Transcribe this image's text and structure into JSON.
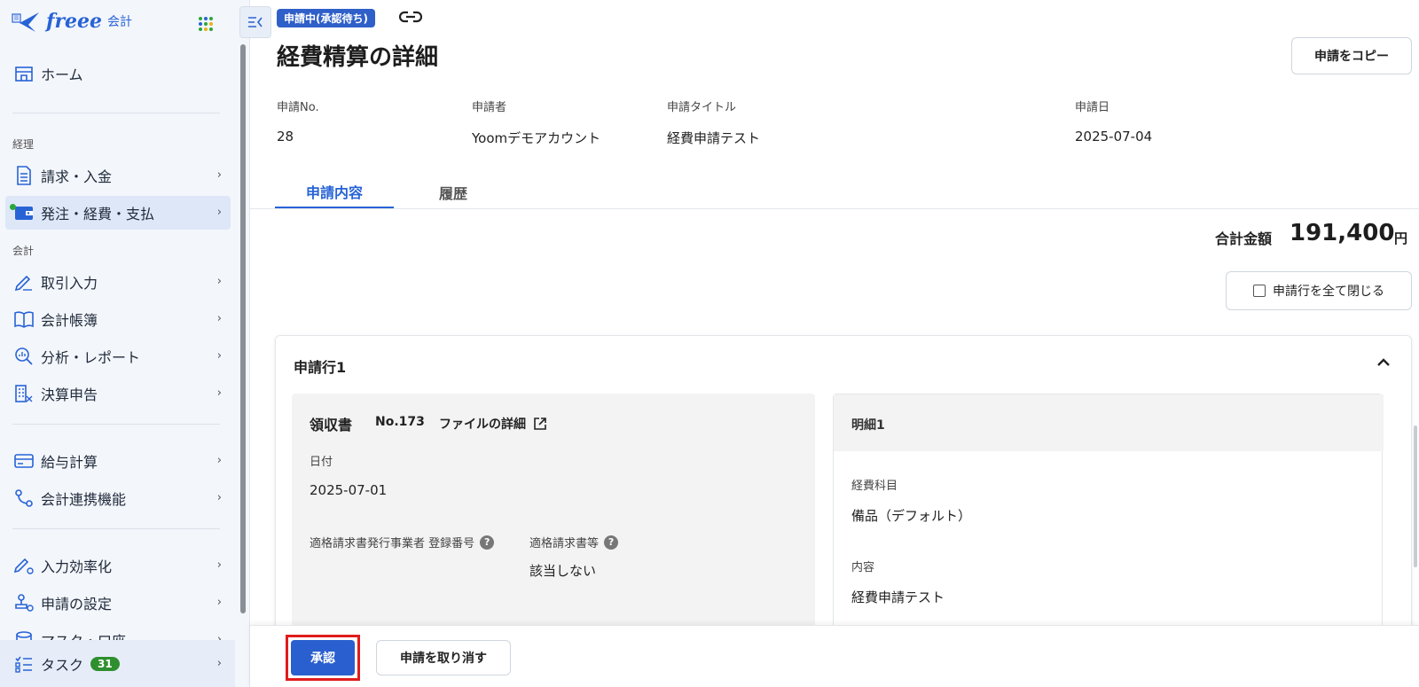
{
  "sidebar": {
    "logo_text": "freee",
    "logo_sub": "会計",
    "home": "ホーム",
    "section_keiri": "経理",
    "section_kaikei": "会計",
    "items_keiri": [
      {
        "label": "請求・入金"
      },
      {
        "label": "発注・経費・支払"
      }
    ],
    "items_kaikei": [
      {
        "label": "取引入力"
      },
      {
        "label": "会計帳簿"
      },
      {
        "label": "分析・レポート"
      },
      {
        "label": "決算申告"
      }
    ],
    "items_other": [
      {
        "label": "給与計算"
      },
      {
        "label": "会計連携機能"
      }
    ],
    "items_settings": [
      {
        "label": "入力効率化"
      },
      {
        "label": "申請の設定"
      },
      {
        "label": "マスタ・口座"
      }
    ],
    "task": {
      "label": "タスク",
      "count": "31"
    },
    "chevron": "›"
  },
  "header": {
    "status": "申請中(承認待ち)",
    "title": "経費精算の詳細",
    "copy_button": "申請をコピー"
  },
  "meta": {
    "labels": [
      "申請No.",
      "申請者",
      "申請タイトル",
      "申請日"
    ],
    "values": [
      "28",
      "Yoomデモアカウント",
      "経費申請テスト",
      "2025-07-04"
    ]
  },
  "tabs": [
    {
      "label": "申請内容",
      "active": true
    },
    {
      "label": "履歴",
      "active": false
    }
  ],
  "total": {
    "label": "合計金額",
    "value": "191,400",
    "unit": "円"
  },
  "collapse_all": "申請行を全て閉じる",
  "line": {
    "title": "申請行1",
    "receipt": {
      "title": "領収書",
      "no": "No.173",
      "file_detail": "ファイルの詳細",
      "date_label": "日付",
      "date_value": "2025-07-01",
      "invoice_reg_label": "適格請求書発行事業者 登録番号",
      "invoice_label": "適格請求書等",
      "invoice_value": "該当しない"
    },
    "detail": {
      "title": "明細1",
      "account_label": "経費科目",
      "account_value": "備品（デフォルト）",
      "content_label": "内容",
      "content_value": "経費申請テスト"
    }
  },
  "footer": {
    "approve": "承認",
    "cancel": "申請を取り消す"
  },
  "colors": {
    "primary": "#2863d6",
    "highlight": "#e01c1c",
    "badge": "#2f8f2f"
  }
}
